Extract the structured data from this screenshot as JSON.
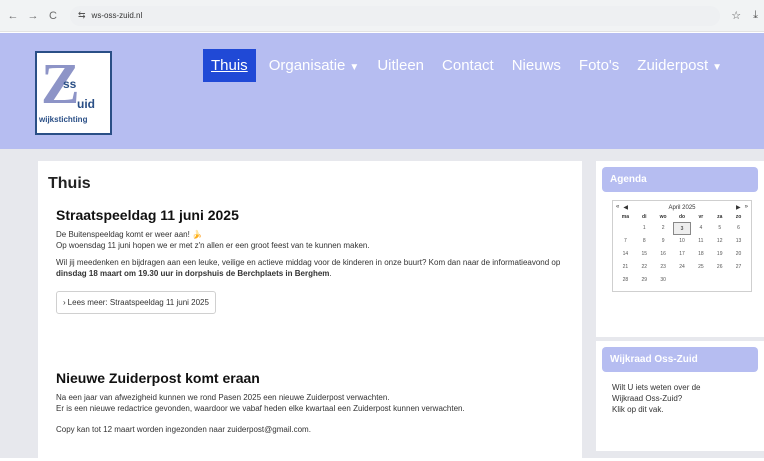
{
  "browser": {
    "url": "ws-oss-zuid.nl",
    "back": "←",
    "forward": "→",
    "reload": "C",
    "site_icon": "⇆",
    "star": "☆",
    "download": "⤓"
  },
  "logo": {
    "z": "Z",
    "ss": "ss",
    "uid": "uid",
    "sub": "wijkstichting"
  },
  "nav": {
    "items": [
      {
        "label": "Thuis",
        "active": true
      },
      {
        "label": "Organisatie",
        "caret": "▼"
      },
      {
        "label": "Uitleen"
      },
      {
        "label": "Contact"
      },
      {
        "label": "Nieuws"
      },
      {
        "label": "Foto's"
      },
      {
        "label": "Zuiderpost",
        "caret": "▼"
      }
    ]
  },
  "main": {
    "title": "Thuis",
    "articles": [
      {
        "title": "Straatspeeldag 11 juni 2025",
        "p1_line1": "De Buitenspeeldag komt er weer aan! 🍌",
        "p1_line2": "Op woensdag 11 juni hopen we er met z'n allen er een groot feest van te kunnen maken.",
        "p2_pre": "Wil jij meedenken en bijdragen aan een leuke, veilige en actieve middag voor de kinderen in onze buurt? Kom dan naar de informatieavond op ",
        "p2_bold": "dinsdag 18 maart om 19.30 uur in dorpshuis de Berchplaets in Berghem",
        "p2_post": ".",
        "readmore": "Lees meer: Straatspeeldag 11 juni 2025"
      },
      {
        "title": "Nieuwe Zuiderpost komt eraan",
        "p1_line1": "Na een jaar van afwezigheid kunnen we rond Pasen 2025 een nieuwe Zuiderpost verwachten.",
        "p1_line2": "Er is een nieuwe redactrice gevonden, waardoor we vabaf heden elke kwartaal een Zuiderpost kunnen verwachten.",
        "p2": "Copy kan tot 12 maart worden ingezonden naar zuiderpost@gmail.com."
      }
    ]
  },
  "agenda": {
    "title": "Agenda",
    "month": "April 2025",
    "weekdays": [
      "ma",
      "di",
      "wo",
      "do",
      "vr",
      "za",
      "zo"
    ],
    "today": "3",
    "rows": [
      [
        "",
        "1",
        "2",
        "3",
        "4",
        "5",
        "6"
      ],
      [
        "7",
        "8",
        "9",
        "10",
        "11",
        "12",
        "13"
      ],
      [
        "14",
        "15",
        "16",
        "17",
        "18",
        "19",
        "20"
      ],
      [
        "21",
        "22",
        "23",
        "24",
        "25",
        "26",
        "27"
      ],
      [
        "28",
        "29",
        "30",
        "",
        "",
        "",
        ""
      ]
    ],
    "btn_prev_year": "«",
    "btn_prev": "◀",
    "btn_next": "▶",
    "btn_next_year": "»"
  },
  "wijkraad": {
    "title": "Wijkraad Oss-Zuid",
    "line1": "Wilt U iets weten over de",
    "line2": "Wijkraad Oss-Zuid?",
    "line3": "Klik op dit vak."
  },
  "colors": {
    "header_bg": "#b6bdf1",
    "nav_active": "#2049d6",
    "logo_border": "#2a4f86"
  }
}
